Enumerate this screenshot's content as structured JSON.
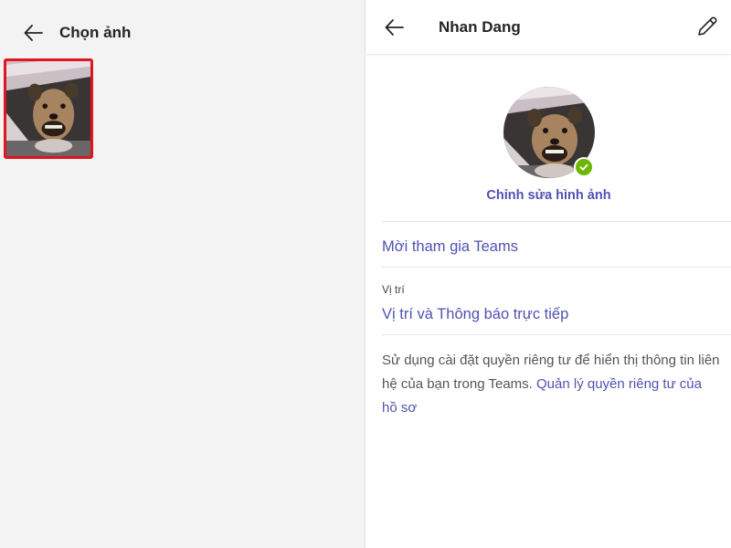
{
  "left_pane": {
    "title": "Chọn ảnh",
    "back_icon": "arrow-left-icon"
  },
  "right_pane": {
    "title": "Nhan Dang",
    "back_icon": "arrow-left-icon",
    "edit_icon": "pencil-icon",
    "presence_icon": "checkmark-icon",
    "presence_color": "#6bb700",
    "edit_photo_label": "Chỉnh sửa hình ảnh",
    "invite_label": "Mời tham gia Teams",
    "location_section_label": "Vị trí",
    "location_link": "Vị trí và Thông báo trực tiếp",
    "privacy_text": "Sử dụng cài đặt quyền riêng tư để hiển thị thông tin liên hệ của bạn trong Teams. ",
    "privacy_link": "Quản lý quyền riêng tư của hồ sơ"
  },
  "colors": {
    "accent": "#4f52b2",
    "selection_border": "#e0151f",
    "left_background": "#f3f3f3"
  }
}
